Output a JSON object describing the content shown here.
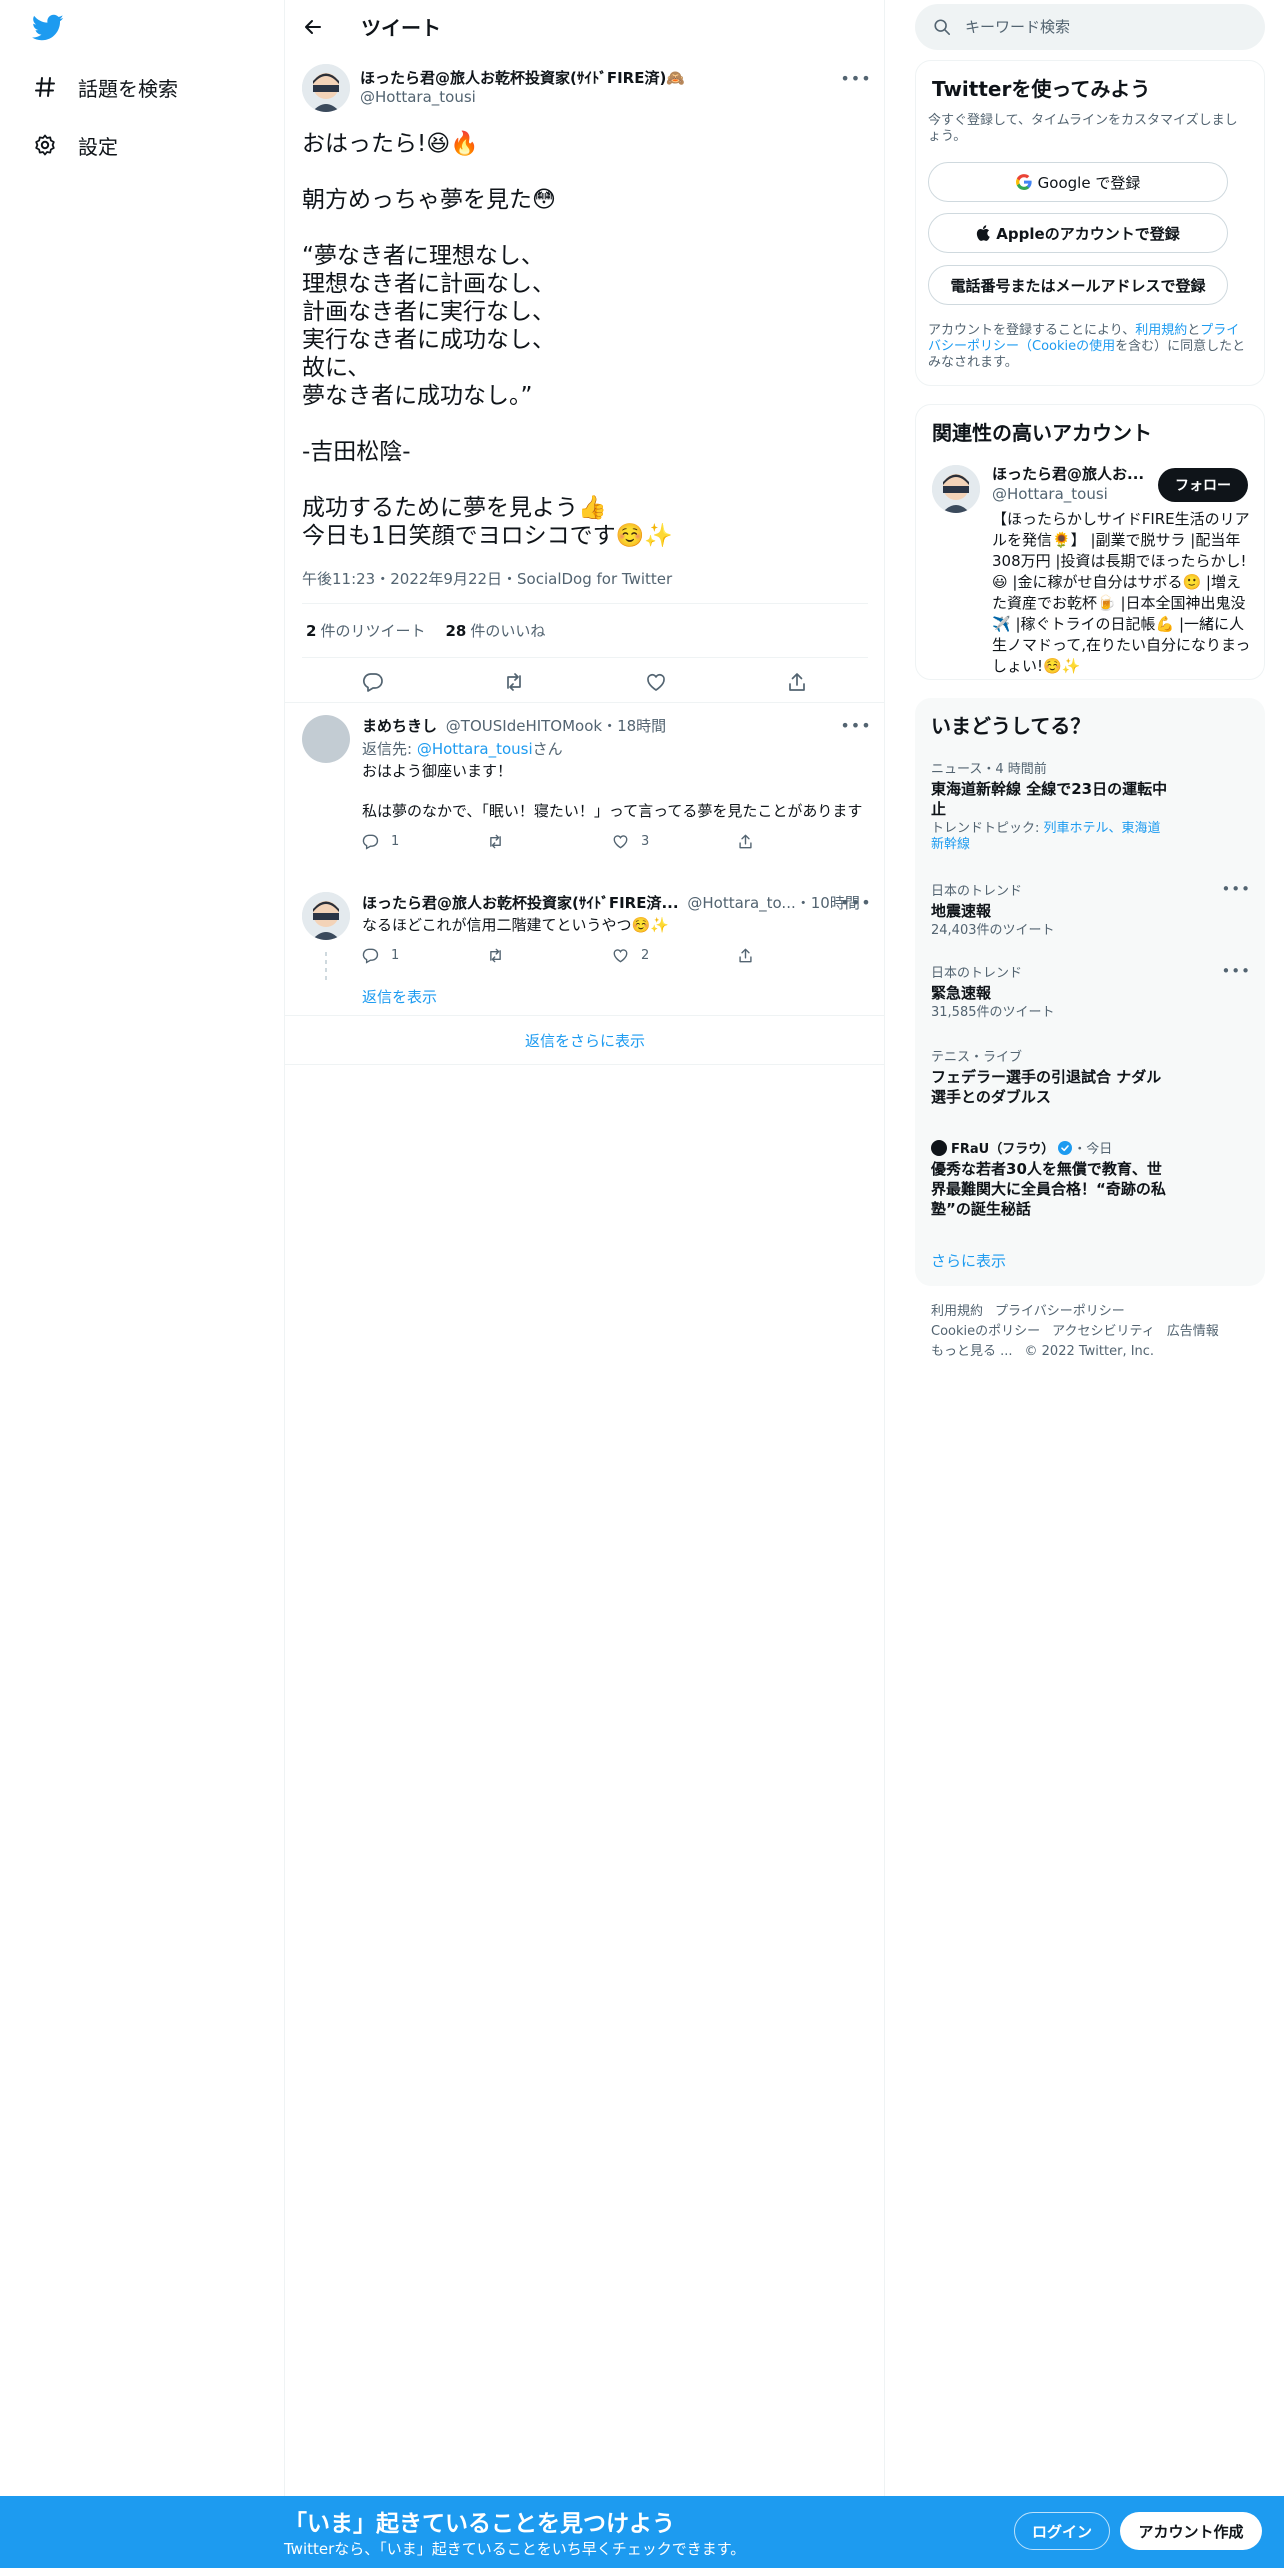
{
  "nav": {
    "items": [
      {
        "label": "話題を検索",
        "icon": "hashtag-icon"
      },
      {
        "label": "設定",
        "icon": "gear-icon"
      }
    ]
  },
  "header": {
    "title": "ツイート"
  },
  "tweet": {
    "author_name": "ほったら君@旅人お乾杯投資家(ｻｲﾄﾞFIRE済)🙈",
    "handle": "@Hottara_tousi",
    "text": "おはったら!😆🔥\n\n朝方めっちゃ夢を見た😳\n\n“夢なき者に理想なし、\n理想なき者に計画なし、\n計画なき者に実行なし、\n実行なき者に成功なし、\n故に、\n夢なき者に成功なし。”\n\n-吉田松陰-\n\n成功するために夢を見よう👍\n今日も1日笑顔でヨロシコです☺️✨",
    "meta": "午後11:23・2022年9月22日・SocialDog for Twitter",
    "retweets_count": "2",
    "retweets_label": "件のリツイート",
    "likes_count": "28",
    "likes_label": "件のいいね"
  },
  "replies": [
    {
      "name": "まめちきし",
      "handle_time": "@TOUSIdeHITOMook・18時間",
      "reply_prefix": "返信先: ",
      "reply_to": "@Hottara_tousi",
      "reply_suffix": "さん",
      "text": "おはよう御座います！\n\n私は夢のなかで、「眠い！寝たい！」って言ってる夢を見たことがあります",
      "reply_count": "1",
      "retweet_count": "",
      "like_count": "3"
    },
    {
      "name": "ほったら君@旅人お乾杯投資家(ｻｲﾄﾞFIRE済...",
      "handle_time": "@Hottara_to...・10時間",
      "text": "なるほどこれが信用二階建てというやつ☺️✨",
      "reply_count": "1",
      "retweet_count": "",
      "like_count": "2"
    }
  ],
  "show_replies": "返信を表示",
  "more_replies": "返信をさらに表示",
  "search": {
    "placeholder": "キーワード検索"
  },
  "signup_card": {
    "title": "Twitterを使ってみよう",
    "subtitle": "今すぐ登録して、タイムラインをカスタマイズしましょう。",
    "google": "Google で登録",
    "apple": "Appleのアカウントで登録",
    "phone": "電話番号またはメールアドレスで登録",
    "legal_1": "アカウントを登録することにより、",
    "legal_terms": "利用規約",
    "legal_2": "と",
    "legal_privacy": "プライバシーポリシー（Cookieの使用",
    "legal_3": "を含む）に同意したとみなされます。"
  },
  "related": {
    "title": "関連性の高いアカウント",
    "name": "ほったら君@旅人お...",
    "handle": "@Hottara_tousi",
    "follow": "フォロー",
    "bio": "【ほったらかしサイドFIRE生活のリアルを発信🌻】 |副業で脱サラ |配当年308万円 |投資は長期でほったらかし!😃 |金に稼がせ自分はサボる🙂 |増えた資産でお乾杯🍺 |日本全国神出鬼没✈️ |稼ぐトライの日記帳💪 |一緒に人生ノマドって,在りたい自分になりまっしょい!☺️✨"
  },
  "trends": {
    "title": "いまどうしてる？",
    "items": [
      {
        "category": "ニュース・4 時間前",
        "name": "東海道新幹線 全線で23日の運転中止",
        "sub_prefix": "トレンドトピック: ",
        "sub_links": "列車ホテル、東海道新幹線"
      },
      {
        "category": "日本のトレンド",
        "name": "地震速報",
        "sub": "24,403件のツイート"
      },
      {
        "category": "日本のトレンド",
        "name": "緊急速報",
        "sub": "31,585件のツイート"
      },
      {
        "category": "テニス・ライブ",
        "name": "フェデラー選手の引退試合 ナダル選手とのダブルス"
      },
      {
        "source": "FRaU（フラウ）",
        "source_time": "・今日",
        "name": "優秀な若者30人を無償で教育、世界最難関大に全員合格！“奇跡の私塾”の誕生秘話"
      }
    ],
    "show_more": "さらに表示"
  },
  "footer": {
    "links": [
      "利用規約",
      "プライバシーポリシー",
      "Cookieのポリシー",
      "アクセシビリティ",
      "広告情報",
      "もっと見る ..."
    ],
    "copyright": "© 2022 Twitter, Inc."
  },
  "bottom_bar": {
    "title": "「いま」起きていることを見つけよう",
    "subtitle": "Twitterなら、「いま」起きていることをいち早くチェックできます。",
    "login": "ログイン",
    "signup": "アカウント作成"
  },
  "colors": {
    "brand": "#1d9bf0",
    "text": "#0f1419",
    "muted": "#536471"
  }
}
